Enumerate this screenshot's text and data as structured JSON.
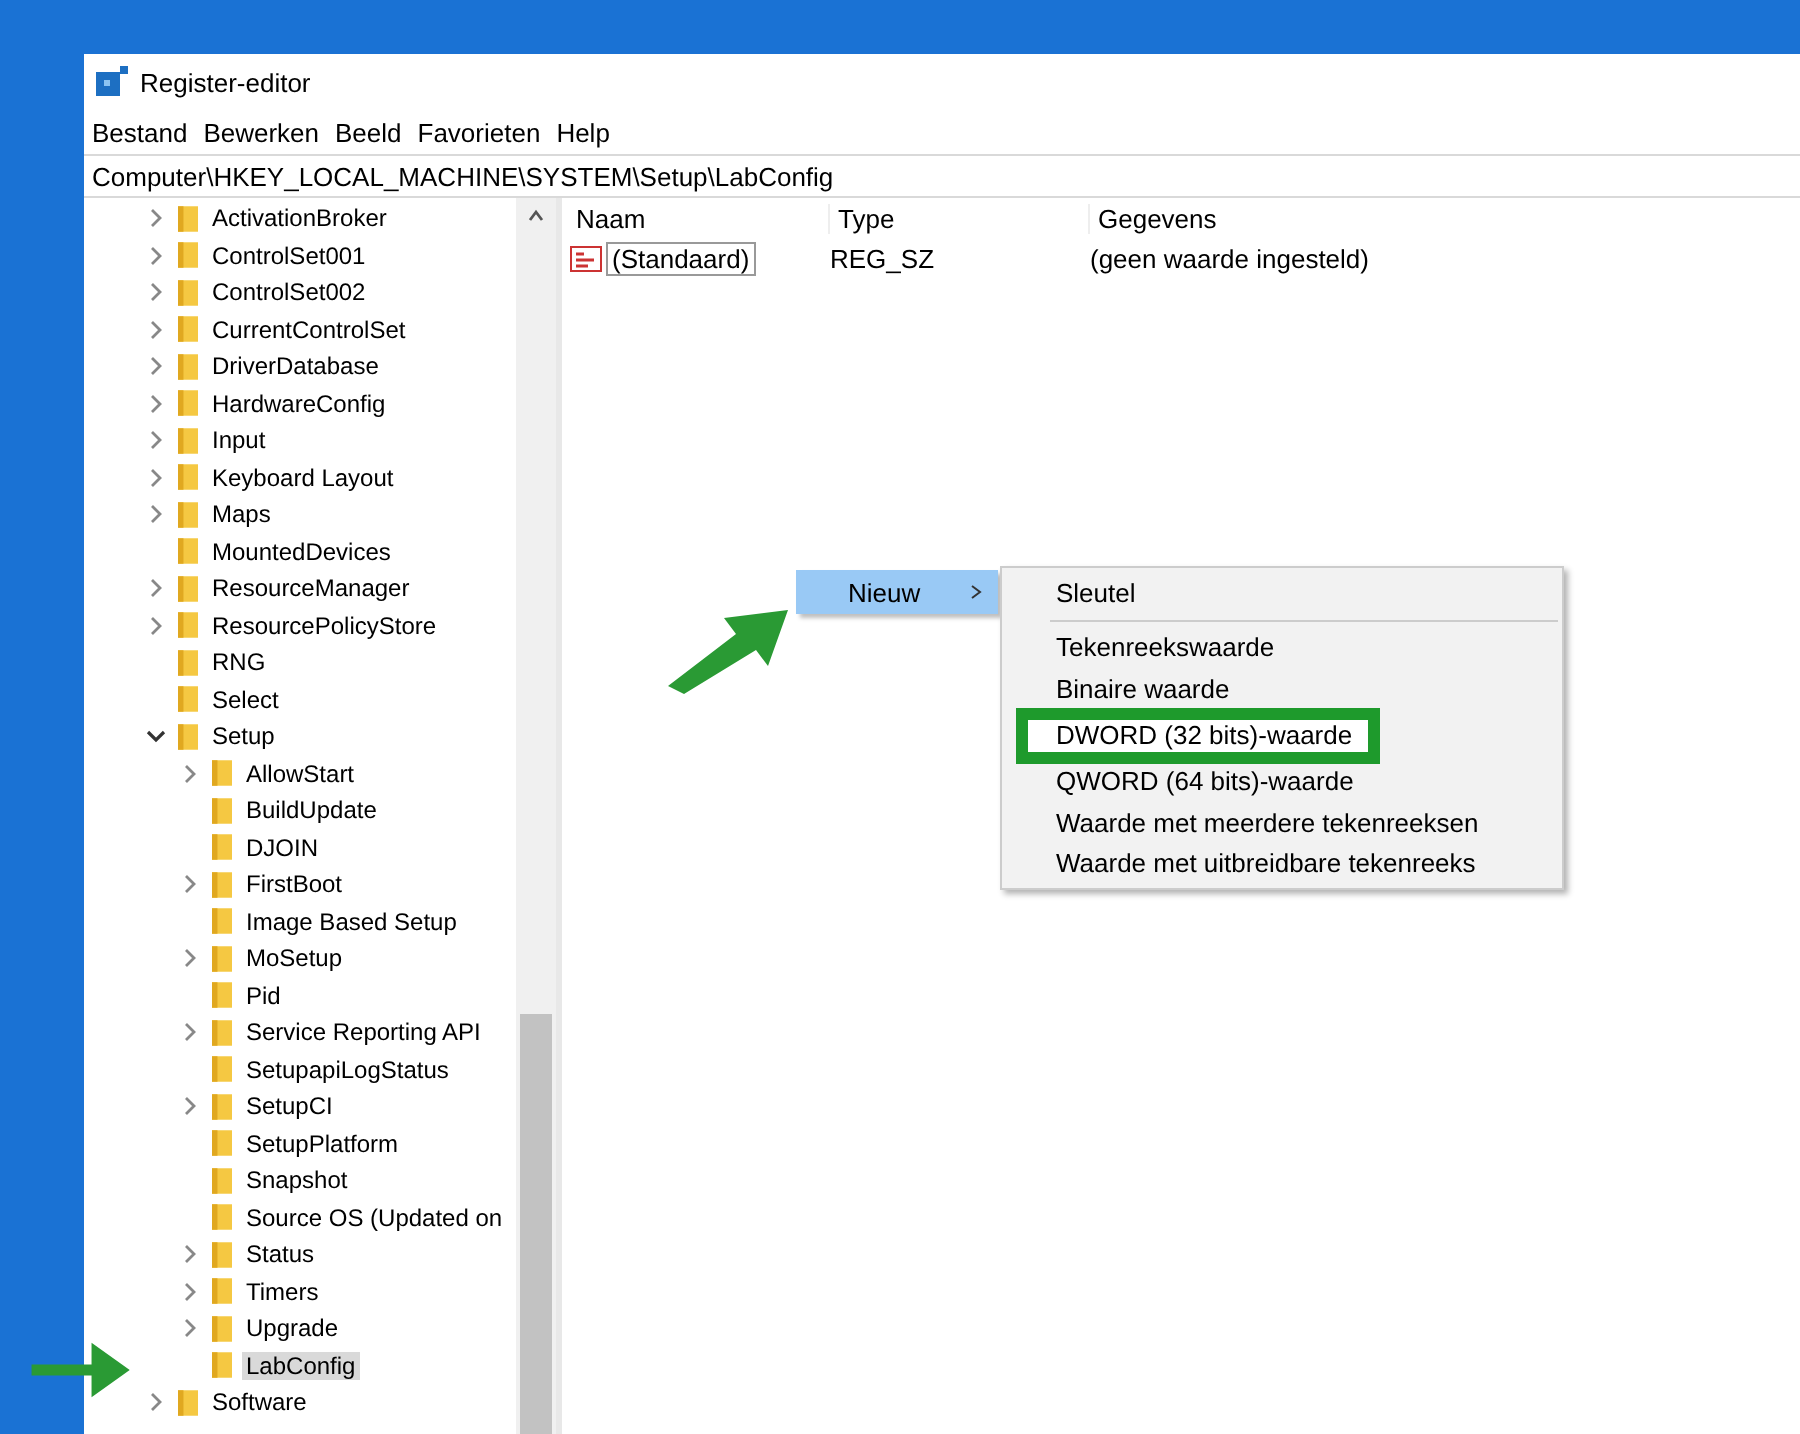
{
  "window": {
    "title": "Register-editor"
  },
  "menu": [
    "Bestand",
    "Bewerken",
    "Beeld",
    "Favorieten",
    "Help"
  ],
  "address": "Computer\\HKEY_LOCAL_MACHINE\\SYSTEM\\Setup\\LabConfig",
  "tree": [
    {
      "label": "ActivationBroker",
      "expandable": true,
      "expanded": false,
      "selected": false
    },
    {
      "label": "ControlSet001",
      "expandable": true,
      "expanded": false,
      "selected": false
    },
    {
      "label": "ControlSet002",
      "expandable": true,
      "expanded": false,
      "selected": false
    },
    {
      "label": "CurrentControlSet",
      "expandable": true,
      "expanded": false,
      "selected": false
    },
    {
      "label": "DriverDatabase",
      "expandable": true,
      "expanded": false,
      "selected": false
    },
    {
      "label": "HardwareConfig",
      "expandable": true,
      "expanded": false,
      "selected": false
    },
    {
      "label": "Input",
      "expandable": true,
      "expanded": false,
      "selected": false
    },
    {
      "label": "Keyboard Layout",
      "expandable": true,
      "expanded": false,
      "selected": false
    },
    {
      "label": "Maps",
      "expandable": true,
      "expanded": false,
      "selected": false
    },
    {
      "label": "MountedDevices",
      "expandable": false,
      "selected": false
    },
    {
      "label": "ResourceManager",
      "expandable": true,
      "expanded": false,
      "selected": false
    },
    {
      "label": "ResourcePolicyStore",
      "expandable": true,
      "expanded": false,
      "selected": false
    },
    {
      "label": "RNG",
      "expandable": false,
      "selected": false
    },
    {
      "label": "Select",
      "expandable": false,
      "selected": false
    },
    {
      "label": "Setup",
      "expandable": true,
      "expanded": true,
      "selected": false,
      "children": [
        {
          "label": "AllowStart",
          "expandable": true,
          "expanded": false,
          "selected": false
        },
        {
          "label": "BuildUpdate",
          "expandable": false,
          "selected": false
        },
        {
          "label": "DJOIN",
          "expandable": false,
          "selected": false
        },
        {
          "label": "FirstBoot",
          "expandable": true,
          "expanded": false,
          "selected": false
        },
        {
          "label": "Image Based Setup",
          "expandable": false,
          "selected": false
        },
        {
          "label": "MoSetup",
          "expandable": true,
          "expanded": false,
          "selected": false
        },
        {
          "label": "Pid",
          "expandable": false,
          "selected": false
        },
        {
          "label": "Service Reporting API",
          "expandable": true,
          "expanded": false,
          "selected": false
        },
        {
          "label": "SetupapiLogStatus",
          "expandable": false,
          "selected": false
        },
        {
          "label": "SetupCI",
          "expandable": true,
          "expanded": false,
          "selected": false
        },
        {
          "label": "SetupPlatform",
          "expandable": false,
          "selected": false
        },
        {
          "label": "Snapshot",
          "expandable": false,
          "selected": false
        },
        {
          "label": "Source OS (Updated on",
          "expandable": false,
          "selected": false
        },
        {
          "label": "Status",
          "expandable": true,
          "expanded": false,
          "selected": false
        },
        {
          "label": "Timers",
          "expandable": true,
          "expanded": false,
          "selected": false
        },
        {
          "label": "Upgrade",
          "expandable": true,
          "expanded": false,
          "selected": false
        },
        {
          "label": "LabConfig",
          "expandable": false,
          "selected": true
        }
      ]
    },
    {
      "label": "Software",
      "expandable": true,
      "expanded": false,
      "selected": false
    }
  ],
  "table": {
    "columns": [
      "Naam",
      "Type",
      "Gegevens"
    ],
    "rows": [
      {
        "name": "(Standaard)",
        "type": "REG_SZ",
        "data": "(geen waarde ingesteld)"
      }
    ]
  },
  "context_menu": {
    "item": "Nieuw",
    "submenu": [
      {
        "label": "Sleutel",
        "highlighted": false
      },
      {
        "label": "Tekenreekswaarde",
        "highlighted": false
      },
      {
        "label": "Binaire waarde",
        "highlighted": false
      },
      {
        "label": "DWORD (32 bits)-waarde",
        "highlighted": true
      },
      {
        "label": "QWORD (64 bits)-waarde",
        "highlighted": false
      },
      {
        "label": "Waarde met meerdere tekenreeksen",
        "highlighted": false
      },
      {
        "label": "Waarde met uitbreidbare tekenreeks",
        "highlighted": false
      }
    ]
  }
}
